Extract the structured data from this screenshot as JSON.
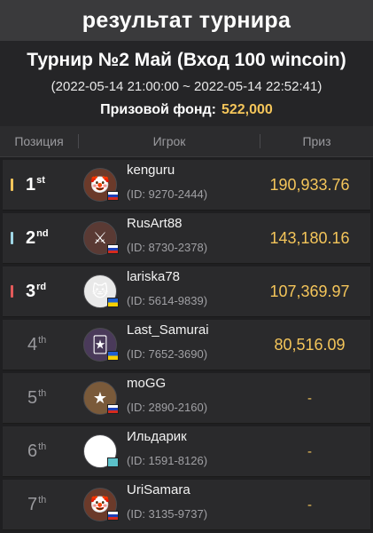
{
  "page": {
    "title": "результат турнира"
  },
  "tournament": {
    "name": "Турнир №2 Май (Вход 100 wincoin)",
    "time": "(2022-05-14 21:00:00 ~ 2022-05-14 22:52:41)",
    "prize_label": "Призовой фонд:",
    "prize_value": "522,000"
  },
  "columns": {
    "position": "Позиция",
    "player": "Игрок",
    "prize": "Приз"
  },
  "rows": [
    {
      "rank": "1",
      "suffix": "st",
      "name": "kenguru",
      "id": "(ID: 9270-2444)",
      "prize": "190,933.76",
      "bar_color": "#f4c55a",
      "flag": "ru",
      "avatar_icon": "clown-avatar-icon"
    },
    {
      "rank": "2",
      "suffix": "nd",
      "name": "RusArt88",
      "id": "(ID: 8730-2378)",
      "prize": "143,180.16",
      "bar_color": "#9fd6e6",
      "flag": "ru",
      "avatar_icon": "warrior-avatar-icon"
    },
    {
      "rank": "3",
      "suffix": "rd",
      "name": "lariska78",
      "id": "(ID: 5614-9839)",
      "prize": "107,369.97",
      "bar_color": "#e35a5a",
      "flag": "ua",
      "avatar_icon": "white-cat-avatar-icon"
    },
    {
      "rank": "4",
      "suffix": "th",
      "name": "Last_Samurai",
      "id": "(ID: 7652-3690)",
      "prize": "80,516.09",
      "bar_color": "",
      "flag": "ua",
      "avatar_icon": "jester-avatar-icon"
    },
    {
      "rank": "5",
      "suffix": "th",
      "name": "moGG",
      "id": "(ID: 2890-2160)",
      "prize": "-",
      "bar_color": "",
      "flag": "ru",
      "avatar_icon": "hero-avatar-icon"
    },
    {
      "rank": "6",
      "suffix": "th",
      "name": "Ильдарик",
      "id": "(ID: 1591-8126)",
      "prize": "-",
      "bar_color": "",
      "flag": "un",
      "avatar_icon": "clover-avatar-icon"
    },
    {
      "rank": "7",
      "suffix": "th",
      "name": "UriSamara",
      "id": "(ID: 3135-9737)",
      "prize": "-",
      "bar_color": "",
      "flag": "ru",
      "avatar_icon": "clown-avatar-icon"
    }
  ]
}
